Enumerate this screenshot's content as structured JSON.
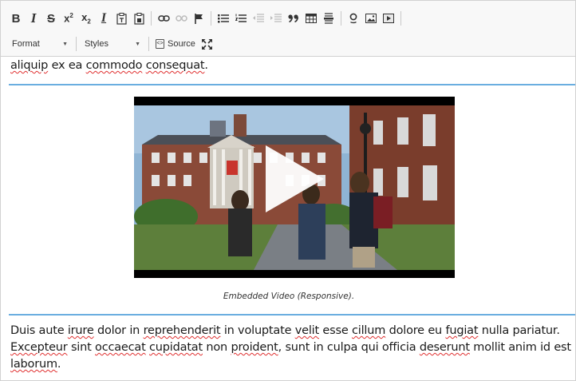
{
  "toolbar": {
    "row1": [
      {
        "name": "bold-button",
        "label": "B"
      },
      {
        "name": "italic-button",
        "label": "I"
      },
      {
        "name": "strikethrough-button",
        "label": "S"
      },
      {
        "name": "superscript-button",
        "label": "x"
      },
      {
        "name": "subscript-button",
        "label": "x"
      },
      {
        "name": "remove-format-button",
        "label": "I"
      }
    ],
    "format_label": "Format",
    "styles_label": "Styles",
    "source_label": "Source"
  },
  "content": {
    "para_top": [
      "aliquip",
      " ex ea ",
      "commodo",
      " ",
      "consequat",
      "."
    ],
    "caption": "Embedded Video (Responsive).",
    "para_bottom": {
      "line1": [
        "Duis aute ",
        "irure",
        " dolor in ",
        "reprehenderit",
        " in voluptate ",
        "velit",
        " esse ",
        "cillum",
        " dolore eu ",
        "fugiat",
        " nulla pariatur."
      ],
      "line2": [
        "Excepteur",
        " sint ",
        "occaecat",
        " ",
        "cupidatat",
        " non ",
        "proident",
        ", sunt in culpa qui officia ",
        "deserunt",
        " mollit anim id est"
      ],
      "line3": [
        "laborum",
        "."
      ]
    }
  },
  "colors": {
    "rule": "#6aaee0",
    "spellcheck": "#e03030",
    "toolbar_bg": "#f8f8f8"
  },
  "icons": [
    "bold-icon",
    "italic-icon",
    "strikethrough-icon",
    "superscript-icon",
    "subscript-icon",
    "remove-format-icon",
    "paste-text-icon",
    "paste-word-icon",
    "link-icon",
    "unlink-icon",
    "anchor-icon",
    "bulleted-list-icon",
    "numbered-list-icon",
    "decrease-indent-icon",
    "increase-indent-icon",
    "blockquote-icon",
    "table-icon",
    "horizontal-line-icon",
    "special-char-icon",
    "image-icon",
    "video-icon",
    "source-icon",
    "maximize-icon"
  ]
}
